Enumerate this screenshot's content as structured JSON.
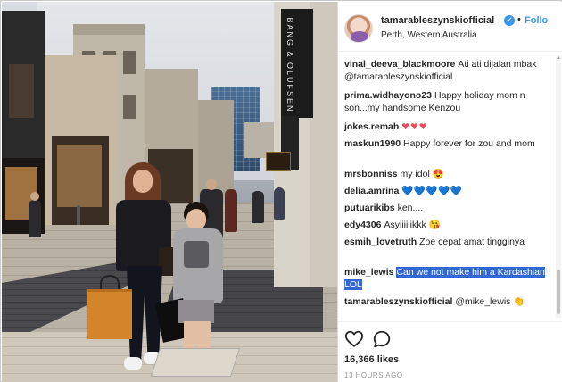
{
  "post": {
    "username": "tamarableszynskiofficial",
    "verified_icon": "verified-badge-icon",
    "separator": "•",
    "follow_label": "Follo",
    "location": "Perth, Western Australia",
    "photo_signs": {
      "banner": "BANG & OLUFSEN"
    }
  },
  "comments": [
    {
      "user": "vinal_deeva_blackmoore",
      "text": "Ati ati dijalan mbak @tamarableszynskiofficial"
    },
    {
      "user": "prima.widhayono23",
      "text": "Happy holiday mom n son...my handsome Kenzou"
    },
    {
      "user": "jokes.remah",
      "text": "❤❤❤"
    },
    {
      "user": "maskun1990",
      "text": "Happy forever for zou and mom"
    },
    {
      "user": "mrsbonniss",
      "text": "my idol 😍"
    },
    {
      "user": "delia.amrina",
      "text": "💙💙💙💙💙"
    },
    {
      "user": "putuarikibs",
      "text": "ken...."
    },
    {
      "user": "edy4306",
      "text": "Asyiiiiiikkk 😘"
    },
    {
      "user": "esmih_lovetruth",
      "text": "Zoe cepat amat tingginya"
    },
    {
      "user": "mike_lewis",
      "text": "Can we not make him a Kardashian LOL"
    },
    {
      "user": "tamarableszynskiofficial",
      "text": "@mike_lewis 👏"
    }
  ],
  "actions": {
    "like_icon": "heart-icon",
    "comment_icon": "comment-icon",
    "likes_text": "16,366 likes",
    "time_ago": "13 HOURS AGO"
  },
  "colors": {
    "link": "#3897f0",
    "highlight": "#3367d6",
    "heart": "#ed4956"
  }
}
